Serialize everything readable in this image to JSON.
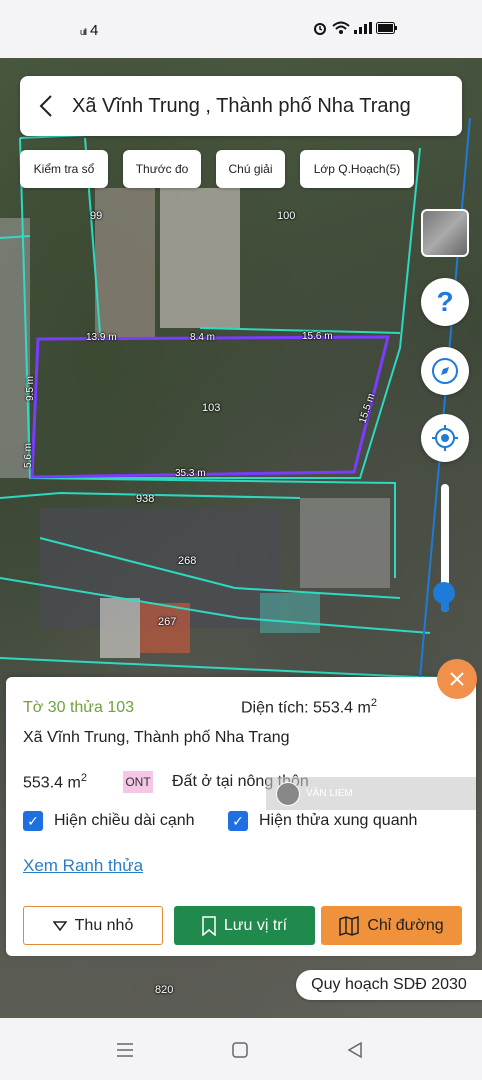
{
  "status_bar": {
    "signal_text": "ull",
    "signal_count": "4",
    "icons": [
      "alarm-icon",
      "wifi-icon",
      "signal-icon",
      "signal-icon",
      "battery-icon"
    ]
  },
  "header": {
    "title": "Xã Vĩnh Trung , Thành phố Nha Trang"
  },
  "toolbar": {
    "chips": [
      "Kiểm tra sổ",
      "Thước đo",
      "Chú giải",
      "Lớp Q.Hoạch(5)"
    ]
  },
  "map": {
    "parcels": [
      "99",
      "100",
      "103",
      "938",
      "268",
      "267",
      "820"
    ],
    "edges": [
      "13.9 m",
      "8.4 m",
      "15.6 m",
      "9.5 m",
      "15.5 m",
      "5.6 m",
      "35.3 m"
    ],
    "zoom_level": 0.15,
    "colors": {
      "parcel_outline": "#7a3cff",
      "cadastral_line": "#2de0c8",
      "road_line": "#1e7bd8"
    }
  },
  "card": {
    "parcel_id": "Tờ 30 thửa 103",
    "area_label": "Diện tích: 553.4 m",
    "area_sup": "2",
    "address": "Xã Vĩnh Trung, Thành phố Nha Trang",
    "area_value": "553.4 m",
    "area_value_sup": "2",
    "land_code": "ONT",
    "land_use": "Đất ở tại nông thôn",
    "checkbox_edges": "Hiện chiều dài cạnh",
    "checkbox_neighbors": "Hiện thửa xung quanh",
    "boundary_link": "Xem Ranh thửa",
    "buttons": {
      "collapse": "Thu nhỏ",
      "save": "Lưu vị trí",
      "directions": "Chỉ đường"
    },
    "colors": {
      "parcel_id": "#6fa23a",
      "save": "#1f8a4c",
      "directions": "#f0923c"
    }
  },
  "watermark": {
    "text": "VĂN LIEM"
  },
  "plan_label": "Quy hoạch SDĐ 2030"
}
